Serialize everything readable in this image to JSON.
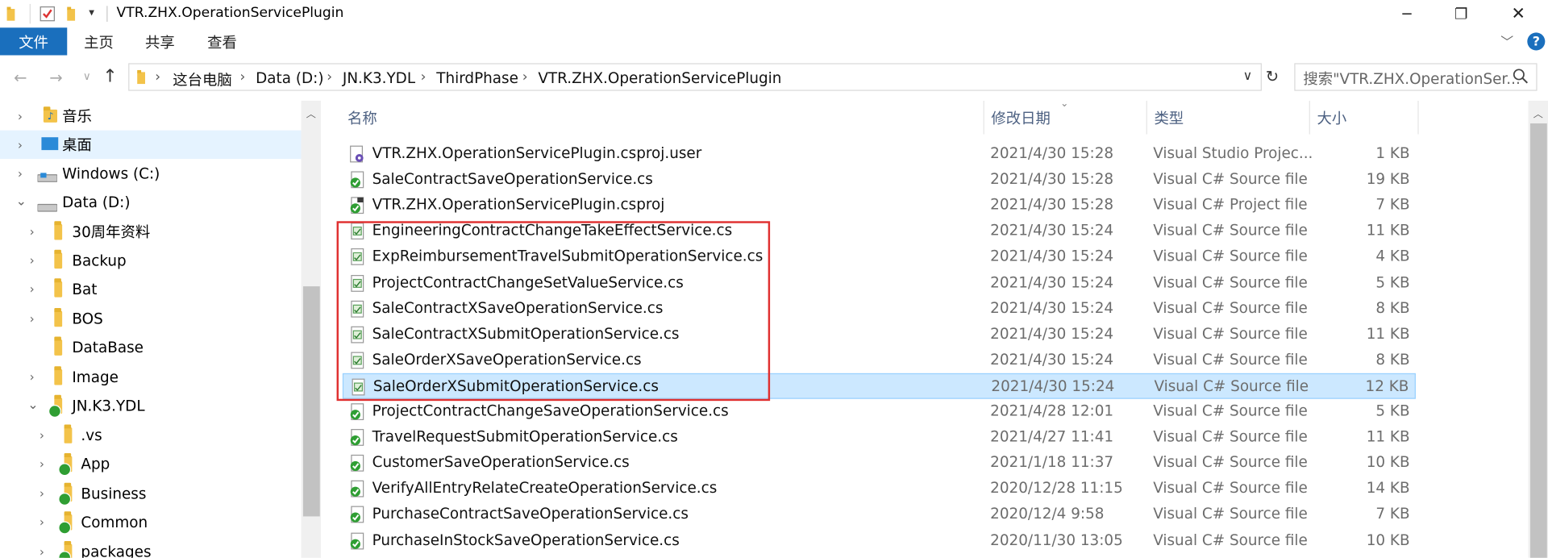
{
  "window": {
    "title": "VTR.ZHX.OperationServicePlugin",
    "controls": {
      "minimize": "─",
      "restore": "❐",
      "close": "✕"
    }
  },
  "ribbon": {
    "tabs": [
      "文件",
      "主页",
      "共享",
      "查看"
    ],
    "help": "?",
    "accent": "#1a6fbd"
  },
  "address": {
    "crumbs": [
      "这台电脑",
      "Data (D:)",
      "JN.K3.YDL",
      "ThirdPhase",
      "VTR.ZHX.OperationServicePlugin"
    ],
    "separator": "›"
  },
  "search": {
    "placeholder": "搜索\"VTR.ZHX.OperationSer..."
  },
  "tree": {
    "items": [
      {
        "label": "音乐",
        "icon": "music-folder-icon"
      },
      {
        "label": "桌面",
        "icon": "desktop-folder-icon"
      },
      {
        "label": "Windows (C:)",
        "icon": "drive-icon"
      },
      {
        "label": "Data (D:)",
        "icon": "drive-icon"
      },
      {
        "label": "30周年资料",
        "icon": "folder-icon"
      },
      {
        "label": "Backup",
        "icon": "folder-icon"
      },
      {
        "label": "Bat",
        "icon": "folder-icon"
      },
      {
        "label": "BOS",
        "icon": "folder-icon"
      },
      {
        "label": "DataBase",
        "icon": "folder-icon"
      },
      {
        "label": "Image",
        "icon": "folder-icon"
      },
      {
        "label": "JN.K3.YDL",
        "icon": "vs-folder-icon"
      },
      {
        "label": ".vs",
        "icon": "folder-icon"
      },
      {
        "label": "App",
        "icon": "vs-folder-icon"
      },
      {
        "label": "Business",
        "icon": "vs-folder-icon"
      },
      {
        "label": "Common",
        "icon": "vs-folder-icon"
      },
      {
        "label": "packages",
        "icon": "vs-folder-icon"
      }
    ]
  },
  "list": {
    "columns": [
      "名称",
      "修改日期",
      "类型",
      "大小"
    ],
    "rows": [
      {
        "name": "VTR.ZHX.OperationServicePlugin.csproj.user",
        "date": "2021/4/30 15:28",
        "type": "Visual Studio Projec...",
        "size": "1 KB",
        "icon": "csproj-user-icon"
      },
      {
        "name": "SaleContractSaveOperationService.cs",
        "date": "2021/4/30 15:28",
        "type": "Visual C# Source file",
        "size": "19 KB",
        "icon": "cs-committed-icon"
      },
      {
        "name": "VTR.ZHX.OperationServicePlugin.csproj",
        "date": "2021/4/30 15:28",
        "type": "Visual C# Project file",
        "size": "7 KB",
        "icon": "csproj-icon"
      },
      {
        "name": "EngineeringContractChangeTakeEffectService.cs",
        "date": "2021/4/30 15:24",
        "type": "Visual C# Source file",
        "size": "11 KB",
        "icon": "cs-file-icon"
      },
      {
        "name": "ExpReimbursementTravelSubmitOperationService.cs",
        "date": "2021/4/30 15:24",
        "type": "Visual C# Source file",
        "size": "4 KB",
        "icon": "cs-file-icon"
      },
      {
        "name": "ProjectContractChangeSetValueService.cs",
        "date": "2021/4/30 15:24",
        "type": "Visual C# Source file",
        "size": "5 KB",
        "icon": "cs-file-icon"
      },
      {
        "name": "SaleContractXSaveOperationService.cs",
        "date": "2021/4/30 15:24",
        "type": "Visual C# Source file",
        "size": "8 KB",
        "icon": "cs-file-icon"
      },
      {
        "name": "SaleContractXSubmitOperationService.cs",
        "date": "2021/4/30 15:24",
        "type": "Visual C# Source file",
        "size": "11 KB",
        "icon": "cs-file-icon"
      },
      {
        "name": "SaleOrderXSaveOperationService.cs",
        "date": "2021/4/30 15:24",
        "type": "Visual C# Source file",
        "size": "8 KB",
        "icon": "cs-file-icon"
      },
      {
        "name": "SaleOrderXSubmitOperationService.cs",
        "date": "2021/4/30 15:24",
        "type": "Visual C# Source file",
        "size": "12 KB",
        "icon": "cs-file-icon"
      },
      {
        "name": "ProjectContractChangeSaveOperationService.cs",
        "date": "2021/4/28 12:01",
        "type": "Visual C# Source file",
        "size": "5 KB",
        "icon": "cs-committed-icon"
      },
      {
        "name": "TravelRequestSubmitOperationService.cs",
        "date": "2021/4/27 11:41",
        "type": "Visual C# Source file",
        "size": "11 KB",
        "icon": "cs-committed-icon"
      },
      {
        "name": "CustomerSaveOperationService.cs",
        "date": "2021/1/18 11:37",
        "type": "Visual C# Source file",
        "size": "10 KB",
        "icon": "cs-committed-icon"
      },
      {
        "name": "VerifyAllEntryRelateCreateOperationService.cs",
        "date": "2020/12/28 11:15",
        "type": "Visual C# Source file",
        "size": "14 KB",
        "icon": "cs-committed-icon"
      },
      {
        "name": "PurchaseContractSaveOperationService.cs",
        "date": "2020/12/4 9:58",
        "type": "Visual C# Source file",
        "size": "7 KB",
        "icon": "cs-committed-icon"
      },
      {
        "name": "PurchaseInStockSaveOperationService.cs",
        "date": "2020/11/30 13:05",
        "type": "Visual C# Source file",
        "size": "10 KB",
        "icon": "cs-committed-icon"
      }
    ]
  }
}
